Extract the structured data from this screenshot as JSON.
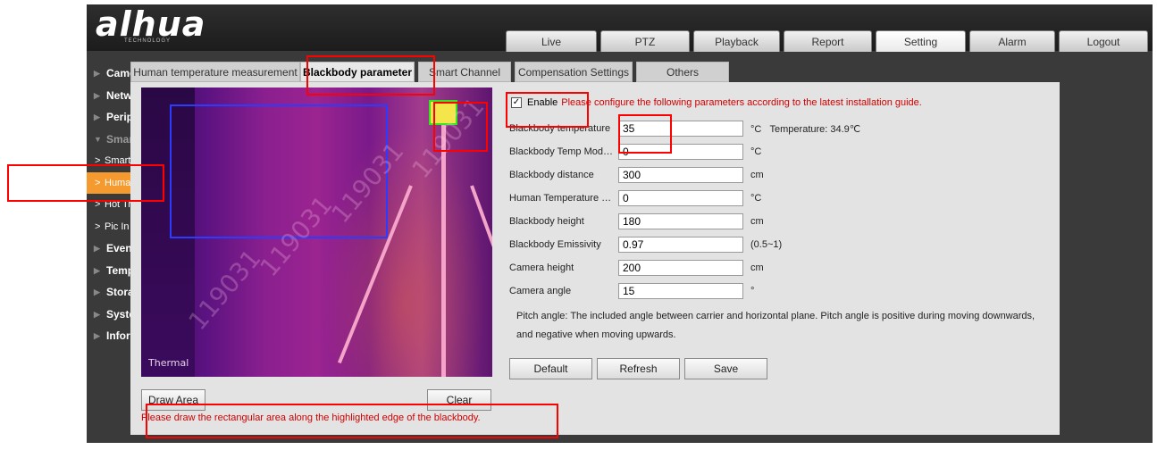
{
  "brand": {
    "logo": "alhua",
    "sub": "TECHNOLOGY"
  },
  "topnav": [
    {
      "label": "Live"
    },
    {
      "label": "PTZ"
    },
    {
      "label": "Playback"
    },
    {
      "label": "Report"
    },
    {
      "label": "Setting",
      "active": true
    },
    {
      "label": "Alarm"
    },
    {
      "label": "Logout"
    }
  ],
  "sidebar": {
    "items": [
      {
        "label": "Camera"
      },
      {
        "label": "Network"
      },
      {
        "label": "Peripheral"
      },
      {
        "label": "Smart Thermal"
      },
      {
        "label": "Smart Plan"
      },
      {
        "label": "Human temperature..."
      },
      {
        "label": "Hot Trace"
      },
      {
        "label": "Pic In Pic"
      },
      {
        "label": "Event"
      },
      {
        "label": "Temperature"
      },
      {
        "label": "Storage"
      },
      {
        "label": "System"
      },
      {
        "label": "Information"
      }
    ]
  },
  "tabs": [
    {
      "label": "Human temperature measurement"
    },
    {
      "label": "Blackbody parameter"
    },
    {
      "label": "Smart Channel"
    },
    {
      "label": "Compensation Settings"
    },
    {
      "label": "Others"
    }
  ],
  "preview": {
    "label": "Thermal",
    "watermark": "119031",
    "draw_area_label": "Draw Area",
    "clear_label": "Clear",
    "warning": "Please draw the rectangular area along the highlighted edge of the blackbody."
  },
  "form": {
    "enable_label": "Enable",
    "enable_checked": true,
    "enable_note": "Please configure the following parameters according to the latest installation guide.",
    "fields": [
      {
        "label": "Blackbody temperature",
        "value": "35",
        "unit": "°C",
        "extra": "Temperature: 34.9℃"
      },
      {
        "label": "Blackbody Temp Modifi...",
        "value": "0",
        "unit": "°C"
      },
      {
        "label": "Blackbody distance",
        "value": "300",
        "unit": "cm"
      },
      {
        "label": "Human Temperature co...",
        "value": "0",
        "unit": "°C"
      },
      {
        "label": "Blackbody height",
        "value": "180",
        "unit": "cm"
      },
      {
        "label": "Blackbody Emissivity",
        "value": "0.97",
        "unit": "(0.5~1)"
      },
      {
        "label": "Camera height",
        "value": "200",
        "unit": "cm"
      },
      {
        "label": "Camera angle",
        "value": "15",
        "unit": "°"
      }
    ],
    "pitch_note": "Pitch angle: The included angle between carrier and horizontal plane. Pitch angle is positive during moving downwards, and negative when moving upwards.",
    "default_label": "Default",
    "refresh_label": "Refresh",
    "save_label": "Save"
  },
  "colors": {
    "accent": "#f59a2f",
    "warning": "#d00000",
    "annotation": "#ff0000"
  }
}
